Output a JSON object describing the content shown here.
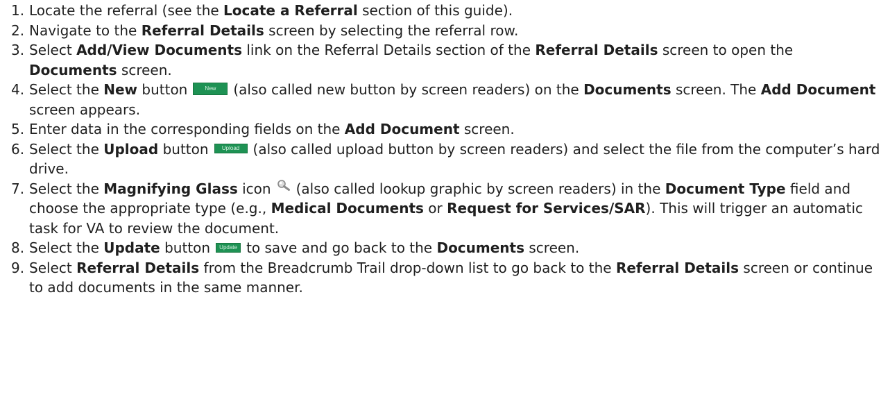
{
  "steps": [
    {
      "n": "1.",
      "t1": "Locate the referral (see the ",
      "b1": "Locate a Referral",
      "t2": " section of this guide)."
    },
    {
      "n": "2.",
      "t1": "Navigate to the ",
      "b1": "Referral Details",
      "t2": " screen by selecting the referral row."
    },
    {
      "n": "3.",
      "t1": "Select ",
      "b1": "Add/View Documents",
      "t2": " link on the Referral Details section of the ",
      "b2": "Referral Details",
      "t3": " screen to open the ",
      "b3": "Documents",
      "t4": " screen."
    },
    {
      "n": "4.",
      "t1": "Select the ",
      "b1": "New",
      "t2": " button",
      "icon": "New",
      "t3": "(also called new button by screen readers) on the ",
      "b2": "Documents",
      "t4": " screen. The ",
      "b3": "Add Document",
      "t5": " screen appears."
    },
    {
      "n": "5.",
      "t1": "Enter data in the corresponding fields on the ",
      "b1": "Add Document",
      "t2": " screen."
    },
    {
      "n": "6.",
      "t1": "Select the ",
      "b1": "Upload",
      "t2": " button",
      "icon": "Upload",
      "t3": "(also called upload button by screen readers) and select the file from the computer’s hard drive."
    },
    {
      "n": "7.",
      "t1": "Select the ",
      "b1": "Magnifying Glass",
      "t2": " icon",
      "t3": "(also called lookup graphic by screen readers) in the ",
      "b2": "Document Type",
      "t4": " field and choose the appropriate type (e.g., ",
      "b3": "Medical Documents",
      "t5": " or ",
      "b4": "Request for Services/SAR",
      "t6": "). This will trigger an automatic task for VA to review the document."
    },
    {
      "n": "8.",
      "t1": "Select the ",
      "b1": "Update",
      "t2": " button",
      "icon": "Update",
      "t3": "to save and go back to the ",
      "b2": "Documents",
      "t4": " screen."
    },
    {
      "n": "9.",
      "t1": "Select ",
      "b1": "Referral Details",
      "t2": " from the Breadcrumb Trail drop-down list to go back to the ",
      "b2": "Referral Details",
      "t3": " screen or continue to add documents in the same manner."
    }
  ],
  "icons": {
    "new_button": "new-button-image",
    "upload_button": "upload-button-image",
    "magnifier": "magnifying-glass-icon",
    "update_button": "update-button-image"
  },
  "colors": {
    "button_green": "#1e9254",
    "text": "#1f1f1f"
  }
}
